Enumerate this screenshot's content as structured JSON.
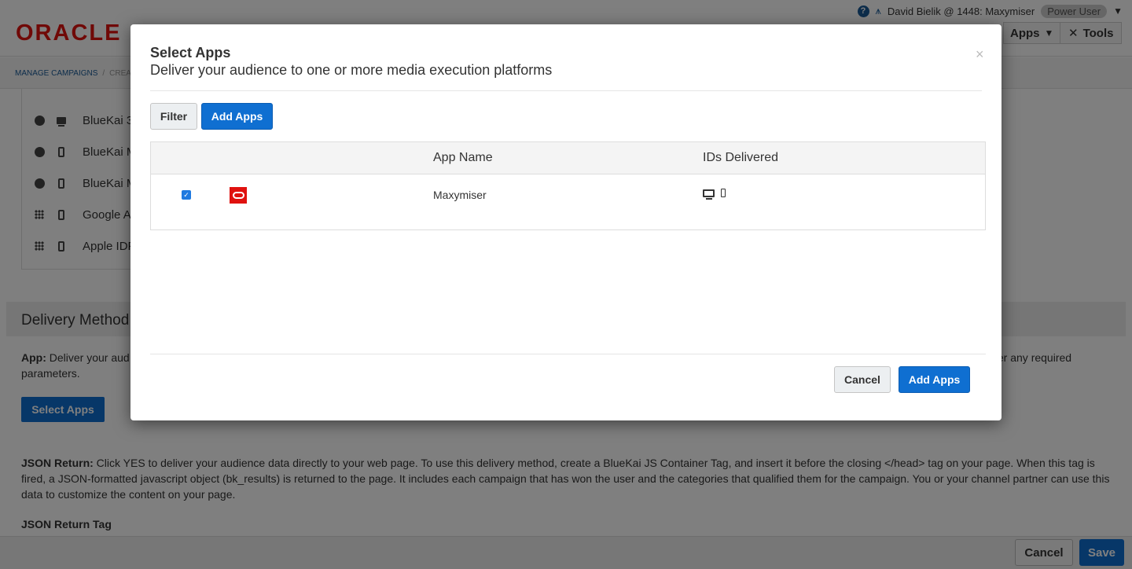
{
  "header": {
    "logo_text": "ORACLE",
    "user_label": "David Bielik @ 1448: Maxymiser",
    "role_badge": "Power User",
    "apps_menu": "Apps",
    "tools_menu": "Tools"
  },
  "breadcrumb": {
    "root": "MANAGE CAMPAIGNS",
    "separator": "/",
    "current": "CREA"
  },
  "background_apps": [
    {
      "label": "BlueKai 3",
      "left_icon": "globe-icon",
      "device_icon": "desktop-icon"
    },
    {
      "label": "BlueKai M",
      "left_icon": "globe-icon",
      "device_icon": "mobile-icon"
    },
    {
      "label": "BlueKai M",
      "left_icon": "globe-icon",
      "device_icon": "mobile-icon"
    },
    {
      "label": "Google A",
      "left_icon": "grid-icon",
      "device_icon": "mobile-icon"
    },
    {
      "label": "Apple IDF",
      "left_icon": "grid-icon",
      "device_icon": "mobile-icon"
    }
  ],
  "delivery": {
    "title": "Delivery Method",
    "app_label": "App:",
    "app_text": " Deliver your aud",
    "app_text_right": "ter any required",
    "app_text_line2": "parameters.",
    "select_apps_button": "Select Apps",
    "json_label": "JSON Return:",
    "json_text": " Click YES to deliver your audience data directly to your web page. To use this delivery method, create a BlueKai JS Container Tag, and insert it before the closing </head> tag on your page. When this tag is fired, a JSON-formatted javascript object (bk_results) is returned to the page. It includes each campaign that has won the user and the categories that qualified them for the campaign. You or your channel partner can use this data to customize the content on your page.",
    "json_tag_title": "JSON Return Tag"
  },
  "footer": {
    "cancel": "Cancel",
    "save": "Save"
  },
  "modal": {
    "title": "Select Apps",
    "subtitle": "Deliver your audience to one or more media execution platforms",
    "close": "×",
    "filter_button": "Filter",
    "add_apps_button": "Add Apps",
    "table": {
      "columns": [
        "App Name",
        "IDs Delivered"
      ],
      "rows": [
        {
          "checked": true,
          "logo": "oracle-logo-icon",
          "app_name": "Maxymiser",
          "ids_delivered": [
            "desktop-icon",
            "mobile-icon"
          ]
        }
      ]
    },
    "cancel_button": "Cancel",
    "confirm_button": "Add Apps"
  },
  "colors": {
    "primary": "#0f6fd1",
    "oracle_red": "#e0120f",
    "overlay": "rgba(0,0,0,0.5)"
  }
}
